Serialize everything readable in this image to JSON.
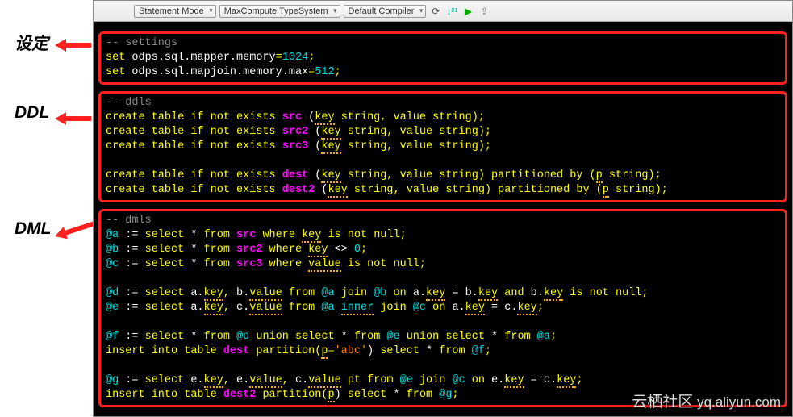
{
  "toolbar": {
    "dropdowns": [
      "Statement Mode",
      "MaxCompute TypeSystem",
      "Default Compiler"
    ]
  },
  "labels": {
    "settings": "设定",
    "ddl": "DDL",
    "dml": "DML"
  },
  "code": {
    "settings": {
      "comment": "-- settings",
      "line1_a": "set",
      "line1_b": " odps.sql.mapper.memory",
      "line1_c": "=",
      "line1_d": "1024",
      "line1_e": ";",
      "line2_a": "set",
      "line2_b": " odps.sql.mapjoin.memory.max",
      "line2_c": "=",
      "line2_d": "512",
      "line2_e": ";"
    },
    "ddl": {
      "comment": "-- ddls",
      "l1a": "create table if not exists ",
      "l1b": "src",
      "l1c": " (",
      "l1d": "key",
      "l1e": " string",
      "l1f": ",",
      "l1g": " value string)",
      "l1h": ";",
      "l2a": "create table if not exists ",
      "l2b": "src2",
      "l2c": " (",
      "l2d": "key",
      "l2e": " string",
      "l2f": ",",
      "l2g": " value string)",
      "l2h": ";",
      "l3a": "create table if not exists ",
      "l3b": "src3",
      "l3c": " (",
      "l3d": "key",
      "l3e": " string",
      "l3f": ",",
      "l3g": " value string)",
      "l3h": ";",
      "l4a": "create table if not exists ",
      "l4b": "dest",
      "l4c": " (",
      "l4d": "key",
      "l4e": " string",
      "l4f": ",",
      "l4g": " value string) partitioned by (",
      "l4h": "p",
      "l4i": " string)",
      "l4j": ";",
      "l5a": "create table if not exists ",
      "l5b": "dest2",
      "l5c": " (",
      "l5d": "key",
      "l5e": " string",
      "l5f": ",",
      "l5g": " value string) partitioned by (",
      "l5h": "p",
      "l5i": " string)",
      "l5j": ";"
    },
    "dml": {
      "comment": "-- dmls",
      "a1": "@a",
      "a2": " := ",
      "a3": "select",
      "a4": " * ",
      "a5": "from ",
      "a6": "src",
      "a7": " where ",
      "a8": "key",
      "a9": " is not null",
      "a10": ";",
      "b1": "@b",
      "b2": " := ",
      "b3": "select",
      "b4": " * ",
      "b5": "from ",
      "b6": "src2",
      "b7": " where ",
      "b8": "key",
      "b9": " <> ",
      "b10": "0",
      "b11": ";",
      "c1": "@c",
      "c2": " := ",
      "c3": "select",
      "c4": " * ",
      "c5": "from ",
      "c6": "src3",
      "c7": " where ",
      "c8": "value",
      "c9": " is not null",
      "c10": ";",
      "d1": "@d",
      "d2": " := ",
      "d3": "select",
      "d4": " a.",
      "d5": "key",
      "d6": ",",
      "d7": " b.",
      "d8": "value",
      "d9": " from ",
      "d10": "@a",
      "d11": " join ",
      "d12": "@b",
      "d13": " on ",
      "d14": "a.",
      "d15": "key",
      "d16": " = ",
      "d17": "b.",
      "d18": "key",
      "d19": " and ",
      "d20": "b.",
      "d21": "key",
      "d22": " is not null",
      "d23": ";",
      "e1": "@e",
      "e2": " := ",
      "e3": "select",
      "e4": " a.",
      "e5": "key",
      "e6": ",",
      "e7": " c.",
      "e8": "value",
      "e9": " from ",
      "e10": "@a",
      "e11": " ",
      "e12": "inner",
      "e13": " join ",
      "e14": "@c",
      "e15": " on ",
      "e16": "a.",
      "e17": "key",
      "e18": " = ",
      "e19": "c.",
      "e20": "key",
      "e21": ";",
      "f1": "@f",
      "f2": " := ",
      "f3": "select",
      "f4": " * ",
      "f5": "from ",
      "f6": "@d",
      "f7": " union ",
      "f8": "select",
      "f9": " * ",
      "f10": "from ",
      "f11": "@e",
      "f12": " union ",
      "f13": "select",
      "f14": " * ",
      "f15": "from ",
      "f16": "@a",
      "f17": ";",
      "i1": "insert into table ",
      "i2": "dest",
      "i3": " partition(",
      "i4": "p",
      "i5": "=",
      "i6": "'abc'",
      "i7": ") ",
      "i8": "select",
      "i9": " * ",
      "i10": "from ",
      "i11": "@f",
      "i12": ";",
      "g1": "@g",
      "g2": " := ",
      "g3": "select",
      "g4": " e.",
      "g5": "key",
      "g6": ",",
      "g7": " e.",
      "g8": "value",
      "g9": ",",
      "g10": " c.",
      "g11": "value",
      "g12": " pt ",
      "g13": "from ",
      "g14": "@e",
      "g15": " join ",
      "g16": "@c",
      "g17": " on ",
      "g18": "e.",
      "g19": "key",
      "g20": " = ",
      "g21": "c.",
      "g22": "key",
      "g23": ";",
      "h1": "insert into table ",
      "h2": "dest2",
      "h3": " partition(",
      "h4": "p",
      "h5": ") ",
      "h6": "select",
      "h7": " * ",
      "h8": "from ",
      "h9": "@g",
      "h10": ";"
    }
  },
  "watermark": {
    "left": "云栖社区",
    "right": "yq.aliyun.com"
  }
}
